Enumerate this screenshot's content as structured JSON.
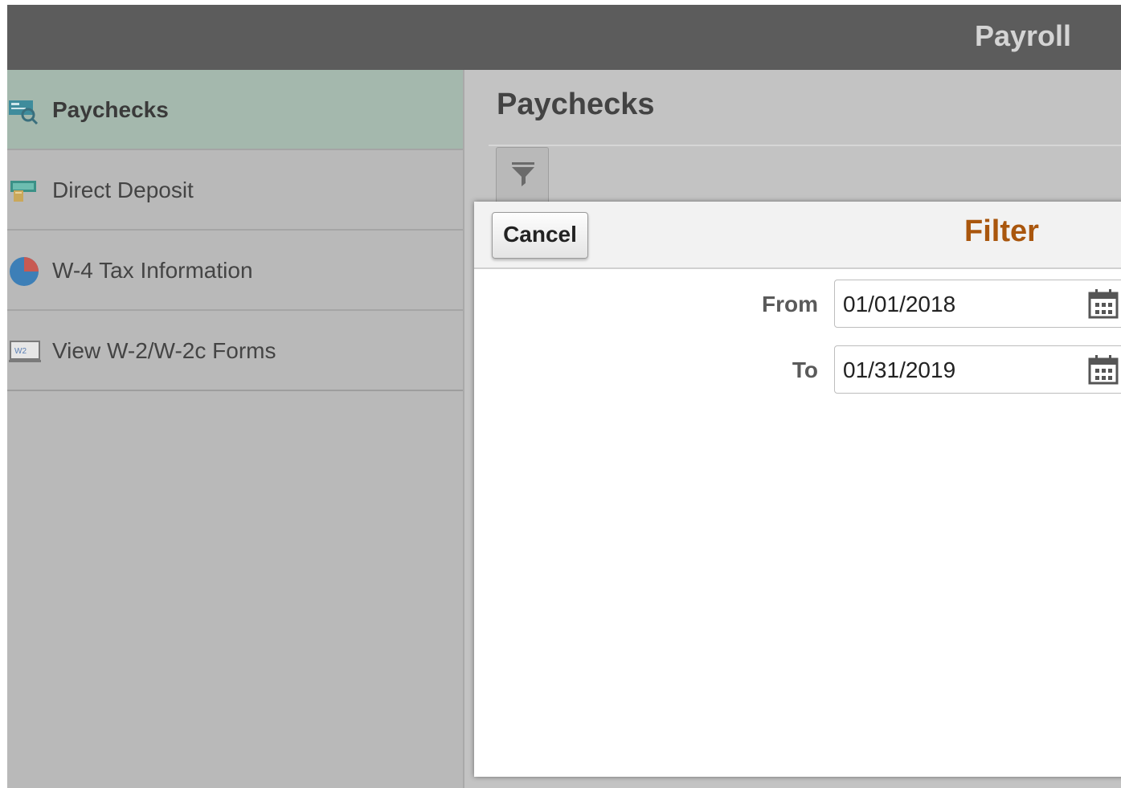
{
  "header": {
    "title": "Payroll"
  },
  "sidebar": {
    "items": [
      {
        "label": "Paychecks",
        "icon": "paycheck-search-icon",
        "active": true
      },
      {
        "label": "Direct Deposit",
        "icon": "money-icon",
        "active": false
      },
      {
        "label": "W-4 Tax Information",
        "icon": "pie-chart-icon",
        "active": false
      },
      {
        "label": "View W-2/W-2c Forms",
        "icon": "w2-form-icon",
        "active": false
      }
    ]
  },
  "main": {
    "title": "Paychecks",
    "filter_icon": "filter-icon"
  },
  "modal": {
    "title": "Filter",
    "cancel_label": "Cancel",
    "from_label": "From",
    "from_value": "01/01/2018",
    "to_label": "To",
    "to_value": "01/31/2019",
    "calendar_icon": "calendar-icon"
  },
  "colors": {
    "header_bg": "#5c5c5c",
    "active_item_bg": "#a4b8ad",
    "modal_title": "#a9560d"
  }
}
